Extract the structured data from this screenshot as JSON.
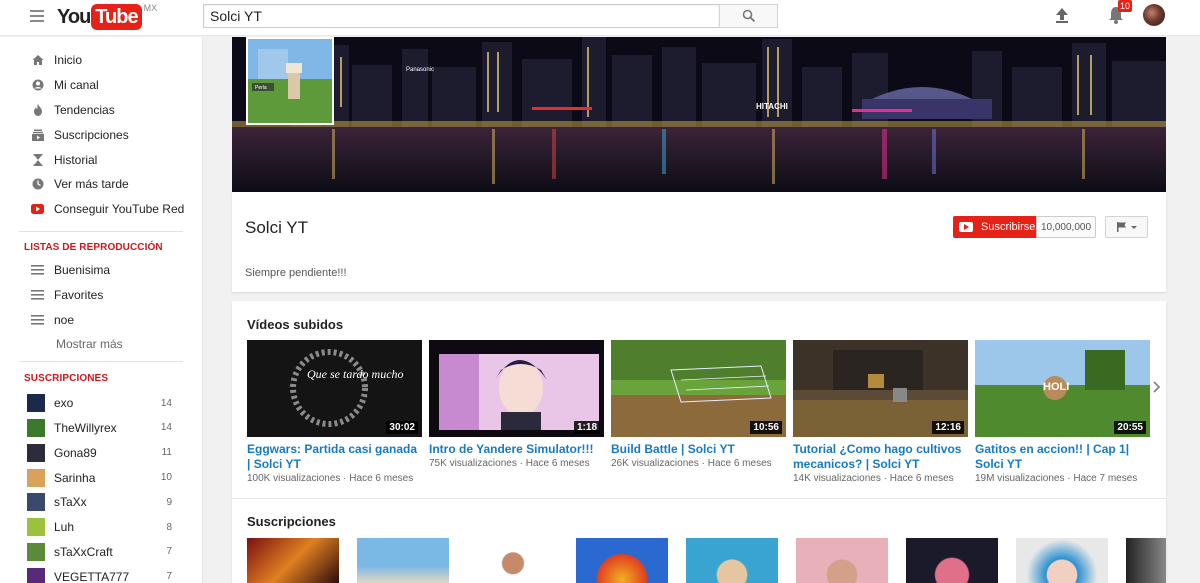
{
  "masthead": {
    "logo_you": "You",
    "logo_tube": "Tube",
    "logo_region": "MX",
    "search_value": "Solci YT",
    "notification_count": "10"
  },
  "sidebar": {
    "nav": [
      {
        "label": "Inicio",
        "icon": "home-icon"
      },
      {
        "label": "Mi canal",
        "icon": "account-icon"
      },
      {
        "label": "Tendencias",
        "icon": "flame-icon"
      },
      {
        "label": "Suscripciones",
        "icon": "subscriptions-icon"
      },
      {
        "label": "Historial",
        "icon": "hourglass-icon"
      },
      {
        "label": "Ver más tarde",
        "icon": "clock-icon"
      },
      {
        "label": "Conseguir YouTube Red",
        "icon": "youtube-red-icon"
      }
    ],
    "playlists_heading": "LISTAS DE REPRODUCCIÓN",
    "playlists": [
      {
        "label": "Buenisima"
      },
      {
        "label": "Favorites"
      },
      {
        "label": "noe"
      }
    ],
    "more_label": "Mostrar más",
    "subscriptions_heading": "SUSCRIPCIONES",
    "subscriptions": [
      {
        "name": "exo",
        "count": "14",
        "color": "#1b2a4a"
      },
      {
        "name": "TheWillyrex",
        "count": "14",
        "color": "#3a7a2a"
      },
      {
        "name": "Gona89",
        "count": "11",
        "color": "#2c2c3a"
      },
      {
        "name": "Sarinha",
        "count": "10",
        "color": "#d9a15a"
      },
      {
        "name": "sTaXx",
        "count": "9",
        "color": "#3b4a6a"
      },
      {
        "name": "Luh",
        "count": "8",
        "color": "#9bc23c"
      },
      {
        "name": "sTaXxCraft",
        "count": "7",
        "color": "#5a8a3a"
      },
      {
        "name": "VEGETTA777",
        "count": "7",
        "color": "#5a2a7a"
      }
    ]
  },
  "channel": {
    "title": "Solci YT",
    "description": "Siempre pendiente!!!",
    "subscribe_label": "Suscribirse",
    "subscriber_count": "10,000,000",
    "banner_labels": [
      "Panasonic",
      "HITACHI"
    ],
    "icon_caption": "Perla"
  },
  "uploads": {
    "heading": "Vídeos subidos",
    "videos": [
      {
        "title": "Eggwars: Partida casi ganada | Solci YT",
        "views": "100K visualizaciones",
        "age": "Hace 6 meses",
        "duration": "30:02",
        "thumb_text": "Que se tardo mucho"
      },
      {
        "title": "Intro de Yandere Simulator!!!",
        "views": "75K visualizaciones",
        "age": "Hace 6 meses",
        "duration": "1:18"
      },
      {
        "title": "Build Battle | Solci YT",
        "views": "26K visualizaciones",
        "age": "Hace 6 meses",
        "duration": "10:56"
      },
      {
        "title": "Tutorial ¿Como hago cultivos mecanicos? | Solci YT",
        "views": "14K visualizaciones",
        "age": "Hace 6 meses",
        "duration": "12:16"
      },
      {
        "title": "Gatitos en accion!! | Cap 1| Solci YT",
        "views": "19M visualizaciones",
        "age": "Hace 7 meses",
        "duration": "20:55",
        "thumb_text": "HOLI"
      }
    ]
  },
  "subscriptions_section": {
    "heading": "Suscripciones"
  }
}
